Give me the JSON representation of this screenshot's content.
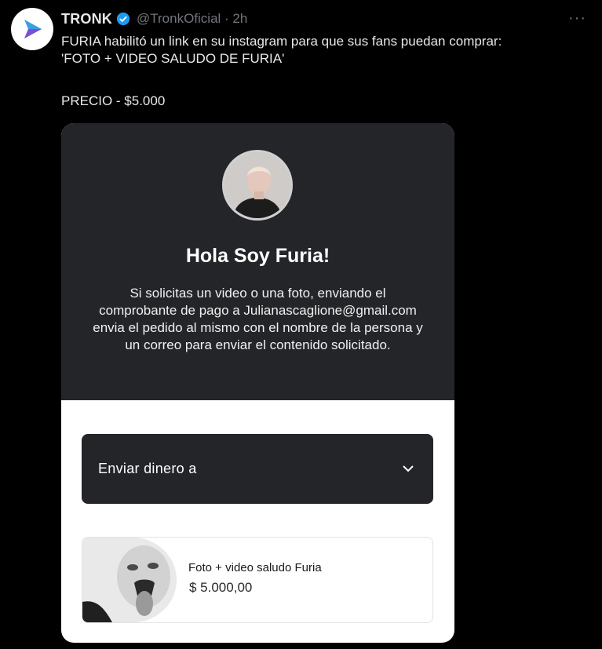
{
  "tweet": {
    "author_name": "TRONK",
    "handle_time": "@TronkOficial · 2h",
    "text_line1": "FURIA habilitó un link en su instagram para que sus fans puedan comprar:",
    "text_line2": "'FOTO + VIDEO SALUDO DE FURIA'",
    "price": "PRECIO - $5.000",
    "more": "···"
  },
  "card": {
    "greeting": "Hola Soy Furia!",
    "description": "Si solicitas un video o una foto, enviando el comprobante de pago a Julianascaglione@gmail.com envia el pedido al mismo con el nombre de la persona y un correo para enviar el contenido solicitado.",
    "dropdown_label": "Enviar dinero a",
    "product": {
      "name": "Foto + video saludo Furia",
      "price": "$ 5.000,00"
    }
  },
  "colors": {
    "background": "#000000",
    "card_dark": "#232528",
    "verified": "#1d9bf0",
    "muted": "#71767b"
  },
  "icons": {
    "logo": "tronk-play-logo-icon",
    "verified": "verified-badge-icon",
    "dropdown": "chevron-down-icon"
  }
}
